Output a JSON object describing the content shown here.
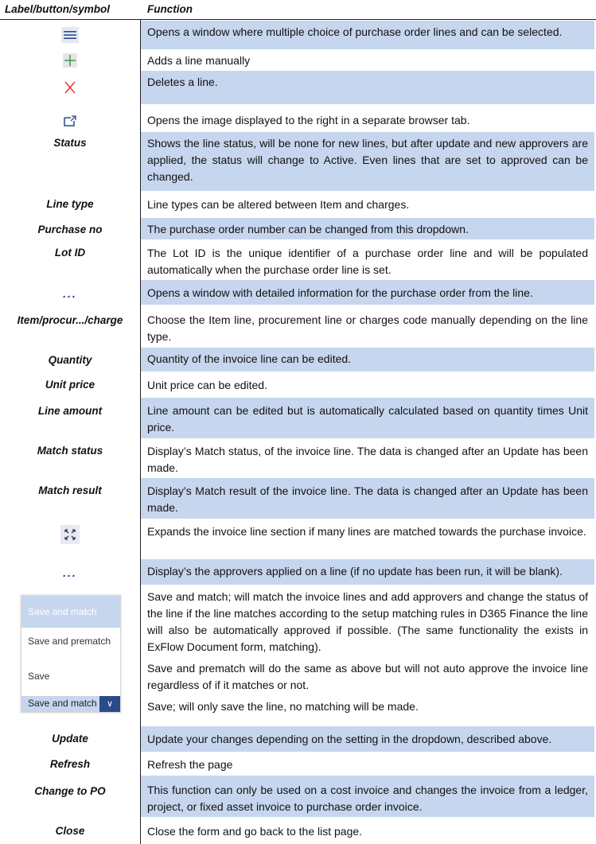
{
  "header": {
    "label_col": "Label/button/symbol",
    "function_col": "Function"
  },
  "rows": [
    {
      "label": "",
      "icon": "list-lines-icon",
      "function": "Opens a window where multiple choice of purchase order lines and can be selected."
    },
    {
      "label": "",
      "icon": "add-plus-icon",
      "function": "Adds a line manually"
    },
    {
      "label": "",
      "icon": "delete-x-icon",
      "function": "Deletes a line."
    },
    {
      "label": "",
      "icon": "open-external-icon",
      "function": "Opens the image displayed to the right in a separate browser tab."
    },
    {
      "label": "Status",
      "function": "Shows the line status, will be none for new lines, but after update and new approvers are applied, the status will change to Active. Even lines that are set to approved can be changed."
    },
    {
      "label": "Line type",
      "function": "Line types can be altered between Item and charges."
    },
    {
      "label": "Purchase no",
      "function": "The purchase order number can be changed from this dropdown."
    },
    {
      "label": "Lot ID",
      "function": "The Lot ID is the unique identifier of a purchase order line and will be populated automatically when the purchase order line is set."
    },
    {
      "label": "...",
      "icon": "more-dots-icon",
      "function": "Opens a window with detailed information for the purchase order from the line."
    },
    {
      "label": "Item/procur.../charge",
      "function": "Choose the Item line, procurement line or charges code manually depending on the line type."
    },
    {
      "label": "Quantity",
      "function": "Quantity of the invoice line can be edited."
    },
    {
      "label": "Unit price",
      "function": "Unit price can be edited."
    },
    {
      "label": "Line amount",
      "function": "Line amount can be edited but is automatically calculated based on quantity times Unit price."
    },
    {
      "label": "Match status",
      "function": "Display’s Match status, of the invoice line. The data is changed after an Update has been made."
    },
    {
      "label": "Match result",
      "function": "Display’s Match result of the invoice line. The data is changed after an Update has been made."
    },
    {
      "label": "",
      "icon": "expand-icon",
      "function": "Expands the invoice line section if many lines are matched towards the purchase invoice."
    },
    {
      "label": "...",
      "icon": "more-dots-icon",
      "function": "Display’s the approvers applied on a line (if no update has been run, it will be blank)."
    },
    {
      "label": "Update",
      "function": "Update your changes depending on the setting in the dropdown, described above."
    },
    {
      "label": "Refresh",
      "function": "Refresh the page"
    },
    {
      "label": "Change to PO",
      "function": "This function can only be used on a cost invoice and changes the invoice from a ledger, project, or fixed asset invoice to purchase order invoice."
    },
    {
      "label": "Close",
      "function": "Close the form and go back to the list page."
    }
  ],
  "save_dropdown": {
    "options": [
      "Save and match",
      "Save and prematch",
      "Save"
    ],
    "selected": "Save and match",
    "descriptions": [
      "Save and match; will match the invoice lines and add approvers and change the status of the line if the line matches according to the setup matching rules in D365 Finance the line will also be automatically approved if possible. (The same functionality the exists in ExFlow Document form, matching).",
      "Save and prematch will do the same as above but will not auto approve the invoice line regardless of if it matches or not.",
      "Save; will only save the line, no matching will be made."
    ]
  },
  "colors": {
    "band": "#c6d6ee",
    "icon_blue": "#2b4a8a",
    "plus_green": "#3aa84a",
    "delete_red": "#e53030"
  }
}
